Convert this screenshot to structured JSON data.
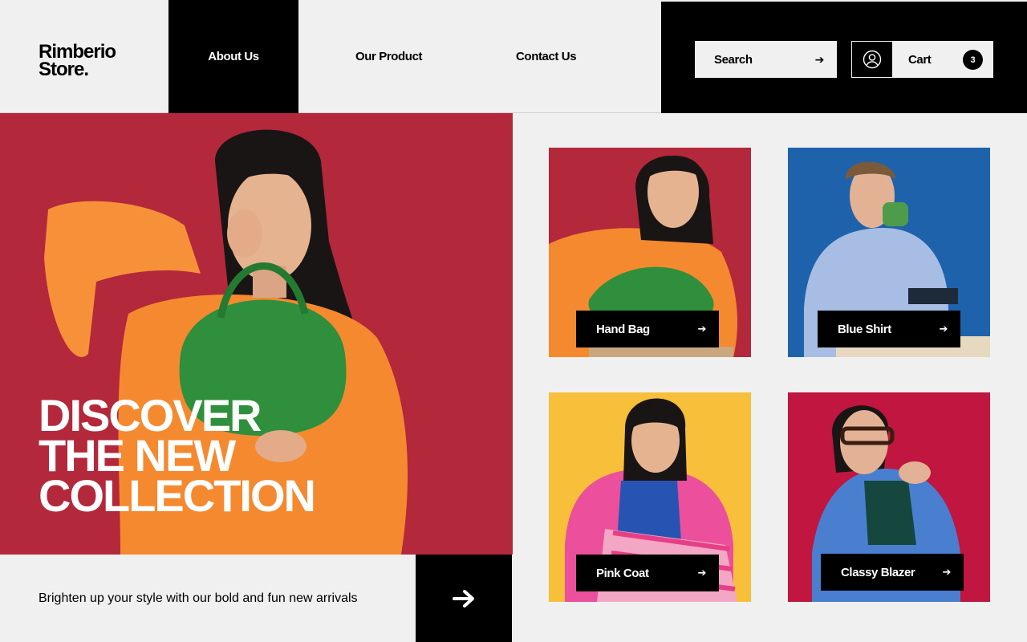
{
  "brand": {
    "line1": "Rimberio",
    "line2": "Store."
  },
  "nav": {
    "about": "About Us",
    "product": "Our Product",
    "contact": "Contact Us"
  },
  "search": {
    "label": "Search",
    "arrow": "➔"
  },
  "cart": {
    "label": "Cart",
    "count": "3"
  },
  "hero": {
    "title_lines": [
      "DISCOVER",
      "THE NEW",
      "COLLECTION"
    ],
    "tagline": "Brighten up your style with our bold and fun new arrivals"
  },
  "products": [
    {
      "name": "Hand Bag",
      "arrow": "➔",
      "bg": "#b3283b"
    },
    {
      "name": "Blue Shirt",
      "arrow": "➔",
      "bg": "#1f62ac"
    },
    {
      "name": "Pink Coat",
      "arrow": "➔",
      "bg": "#f7bf3a"
    },
    {
      "name": "Classy Blazer",
      "arrow": "➔",
      "bg": "#c0163f"
    }
  ],
  "colors": {
    "dark": "#000000",
    "light": "#f0f0f0",
    "hero_bg": "#b3283b",
    "accent_orange": "#f5892f",
    "accent_green": "#2f8f3c"
  }
}
